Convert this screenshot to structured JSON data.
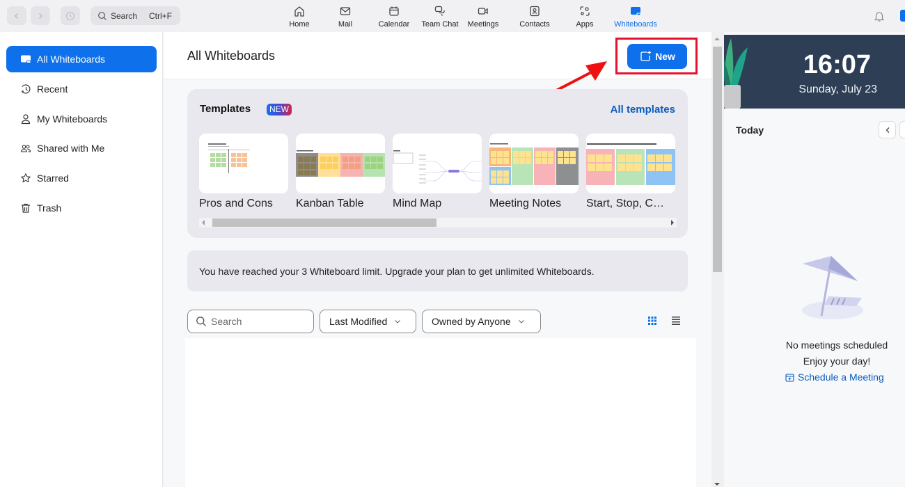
{
  "topbar": {
    "search_label": "Search",
    "search_shortcut": "Ctrl+F",
    "tabs": [
      {
        "label": "Home",
        "icon": "home-icon"
      },
      {
        "label": "Mail",
        "icon": "mail-icon"
      },
      {
        "label": "Calendar",
        "icon": "calendar-icon"
      },
      {
        "label": "Team Chat",
        "icon": "chat-icon"
      },
      {
        "label": "Meetings",
        "icon": "video-icon"
      },
      {
        "label": "Contacts",
        "icon": "contacts-icon"
      },
      {
        "label": "Apps",
        "icon": "apps-icon"
      },
      {
        "label": "Whiteboards",
        "icon": "whiteboard-icon",
        "active": true
      }
    ]
  },
  "sidebar": {
    "items": [
      {
        "label": "All Whiteboards",
        "icon": "whiteboard-icon",
        "active": true
      },
      {
        "label": "Recent",
        "icon": "clock-history-icon"
      },
      {
        "label": "My Whiteboards",
        "icon": "person-icon"
      },
      {
        "label": "Shared with Me",
        "icon": "people-icon"
      },
      {
        "label": "Starred",
        "icon": "star-icon"
      },
      {
        "label": "Trash",
        "icon": "trash-icon"
      }
    ]
  },
  "main": {
    "title": "All Whiteboards",
    "new_button": "New",
    "templates": {
      "title": "Templates",
      "badge": "NEW",
      "all_link": "All templates",
      "items": [
        {
          "label": "Pros and Cons"
        },
        {
          "label": "Kanban Table"
        },
        {
          "label": "Mind Map"
        },
        {
          "label": "Meeting Notes"
        },
        {
          "label": "Start, Stop, C…"
        }
      ]
    },
    "limit_banner": "You have reached your 3 Whiteboard limit. Upgrade your plan to get unlimited Whiteboards.",
    "filters": {
      "search_placeholder": "Search",
      "sort": "Last Modified",
      "owner": "Owned by Anyone"
    }
  },
  "right_panel": {
    "time": "16:07",
    "date": "Sunday, July 23",
    "today_label": "Today",
    "empty_title": "No meetings scheduled",
    "empty_subtitle": "Enjoy your day!",
    "schedule_link": "Schedule a Meeting"
  },
  "colors": {
    "accent": "#0e71eb",
    "highlight": "#e8102e",
    "link": "#0b5cbd",
    "clock_bg": "#2d3e55"
  }
}
